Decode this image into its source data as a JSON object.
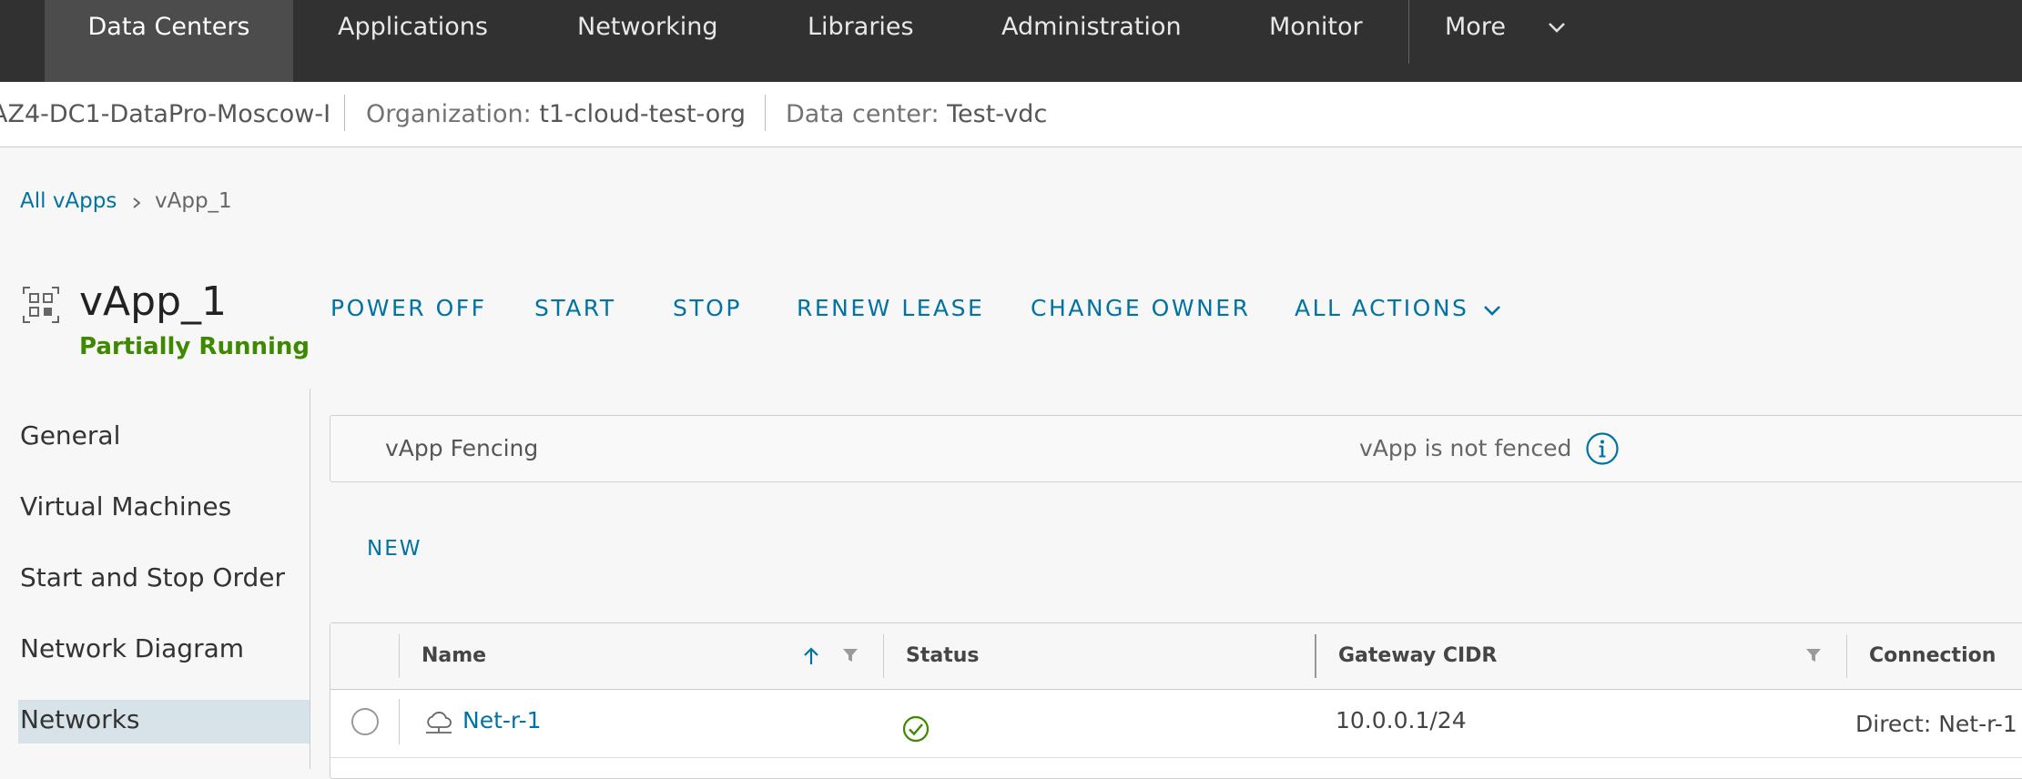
{
  "nav": {
    "items": [
      "Data Centers",
      "Applications",
      "Networking",
      "Libraries",
      "Administration",
      "Monitor"
    ],
    "more": "More",
    "active_index": 0
  },
  "context": {
    "site": "AZ4-DC1-DataPro-Moscow-I",
    "org_label": "Organization:",
    "org_value": "t1-cloud-test-org",
    "dc_label": "Data center:",
    "dc_value": "Test-vdc"
  },
  "breadcrumb": {
    "parent": "All vApps",
    "current": "vApp_1"
  },
  "header": {
    "title": "vApp_1",
    "status": "Partially Running",
    "actions": [
      "POWER OFF",
      "START",
      "STOP",
      "RENEW LEASE",
      "CHANGE OWNER",
      "ALL ACTIONS"
    ]
  },
  "sidebar": {
    "items": [
      "General",
      "Virtual Machines",
      "Start and Stop Order",
      "Network Diagram",
      "Networks"
    ],
    "active_index": 4
  },
  "fencing": {
    "label": "vApp Fencing",
    "value": "vApp is not fenced"
  },
  "toolbar": {
    "new_label": "NEW"
  },
  "grid": {
    "columns": [
      "Name",
      "Status",
      "Gateway CIDR",
      "Connection"
    ],
    "rows": [
      {
        "name": "Net-r-1",
        "status": "ok",
        "gateway_cidr": "10.0.0.1/24",
        "connection": "Direct: Net-r-1"
      }
    ]
  },
  "colors": {
    "accent": "#0072a3",
    "status_running": "#3d8a00",
    "nav_bg": "#313131"
  }
}
